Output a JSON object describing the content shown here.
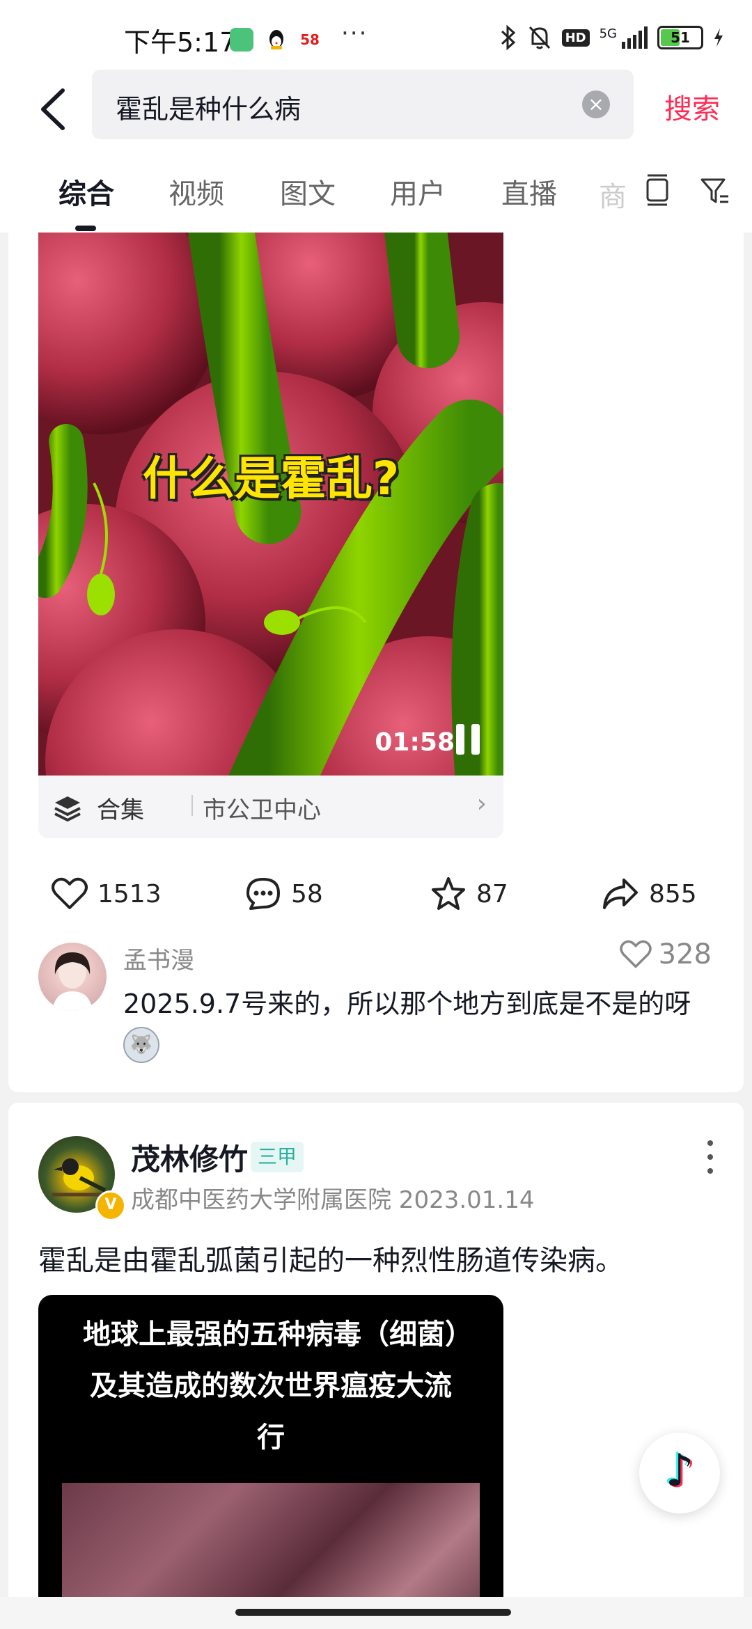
{
  "status_bar": {
    "time": "下午5:17",
    "app_badge": "58",
    "more_dots": "···",
    "network": "5G",
    "hd": "HD",
    "battery": "51",
    "battery_level_percent": 51
  },
  "search": {
    "query": "霍乱是种什么病",
    "clear_glyph": "×",
    "submit_label": "搜索"
  },
  "tabs": [
    {
      "label": "综合",
      "active": true
    },
    {
      "label": "视频",
      "active": false
    },
    {
      "label": "图文",
      "active": false
    },
    {
      "label": "用户",
      "active": false
    },
    {
      "label": "直播",
      "active": false
    },
    {
      "label": "商",
      "active": false
    }
  ],
  "result1": {
    "video_title": "什么是霍乱?",
    "duration": "01:58",
    "collection_label": "合集",
    "collection_source": "市公卫中心",
    "likes": "1513",
    "comments": "58",
    "favorites": "87",
    "shares": "855",
    "top_comment": {
      "user": "孟书漫",
      "likes": "328",
      "text": "2025.9.7号来的，所以那个地方到底是不是的呀"
    }
  },
  "result2": {
    "author": "茂林修竹",
    "badge": "三甲",
    "meta": "成都中医药大学附属医院 2023.01.14",
    "verified_glyph": "V",
    "text": "霍乱是由霍乱弧菌引起的一种烈性肠道传染病。",
    "image_caption": "地球上最强的五种病毒（细菌）及其造成的数次世界瘟疫大流行"
  },
  "fab_glyph": "♪",
  "colors": {
    "accent": "#fe2c55",
    "badge_text": "#2ab0a0",
    "video_title": "#ffe500"
  }
}
